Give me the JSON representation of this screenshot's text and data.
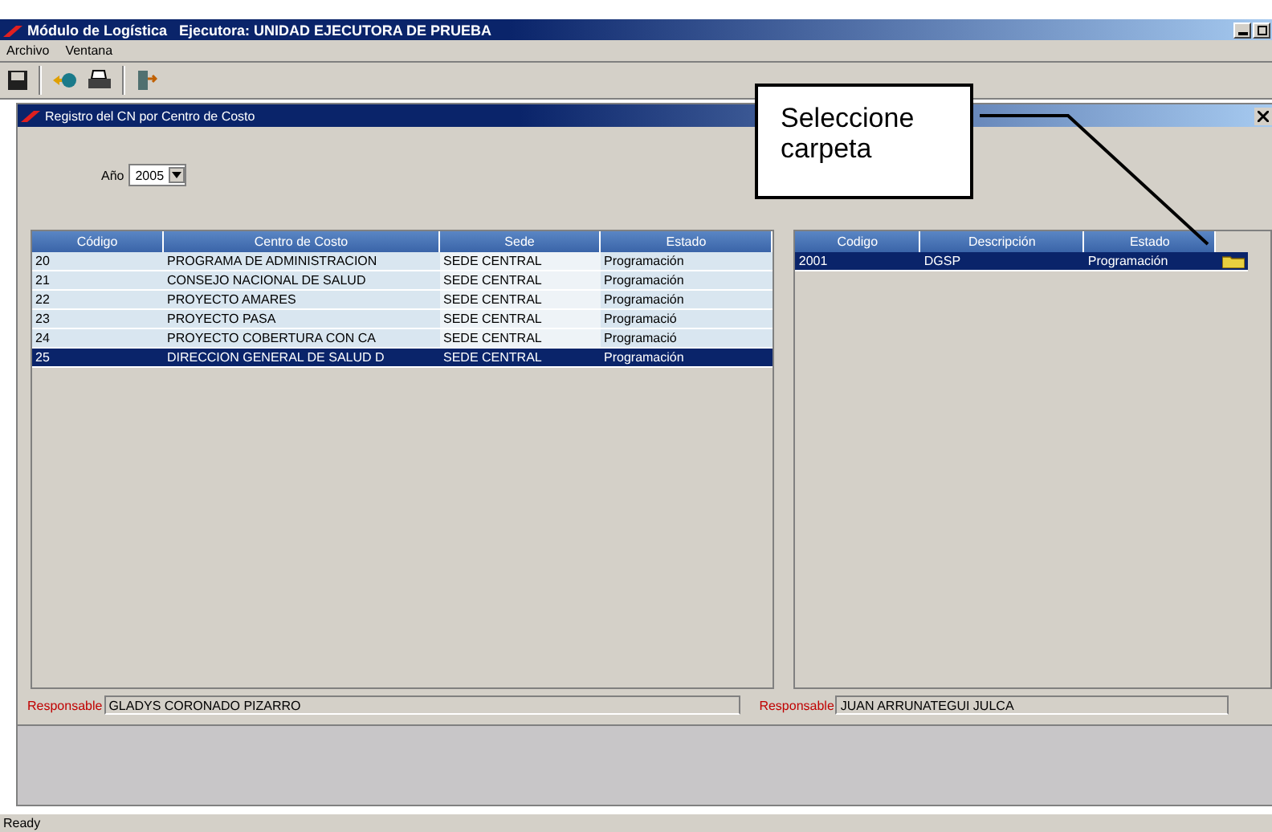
{
  "window": {
    "title": "Módulo de Logística   Ejecutora: UNIDAD EJECUTORA DE PRUEBA"
  },
  "menu": [
    "Archivo",
    "Ventana"
  ],
  "child_window": {
    "title": "Registro del CN por Centro de Costo"
  },
  "year": {
    "label": "Año",
    "value": "2005"
  },
  "left_table": {
    "columns": [
      "Código",
      "Centro de Costo",
      "Sede",
      "Estado"
    ],
    "rows": [
      {
        "cells": [
          "20",
          "PROGRAMA DE ADMINISTRACION",
          "SEDE CENTRAL",
          "Programación"
        ],
        "selected": false
      },
      {
        "cells": [
          "21",
          "CONSEJO NACIONAL DE SALUD",
          "SEDE CENTRAL",
          "Programación"
        ],
        "selected": false
      },
      {
        "cells": [
          "22",
          "PROYECTO AMARES",
          "SEDE CENTRAL",
          "Programación"
        ],
        "selected": false
      },
      {
        "cells": [
          "23",
          "PROYECTO PASA",
          "SEDE CENTRAL",
          "Programació"
        ],
        "selected": false
      },
      {
        "cells": [
          "24",
          "PROYECTO COBERTURA CON CA",
          "SEDE CENTRAL",
          "Programació"
        ],
        "selected": false
      },
      {
        "cells": [
          "25",
          "DIRECCION GENERAL DE SALUD D",
          "SEDE CENTRAL",
          "Programación"
        ],
        "selected": true
      }
    ]
  },
  "right_table": {
    "columns": [
      "Codigo",
      "Descripción",
      "Estado"
    ],
    "rows": [
      {
        "cells": [
          "2001",
          "DGSP",
          "Programación"
        ],
        "selected": true
      }
    ]
  },
  "left_responsible": {
    "label": "Responsable",
    "value": "GLADYS CORONADO PIZARRO"
  },
  "right_responsible": {
    "label": "Responsable",
    "value": "JUAN ARRUNATEGUI JULCA"
  },
  "callout": "Seleccione carpeta",
  "status_bar": "Ready"
}
